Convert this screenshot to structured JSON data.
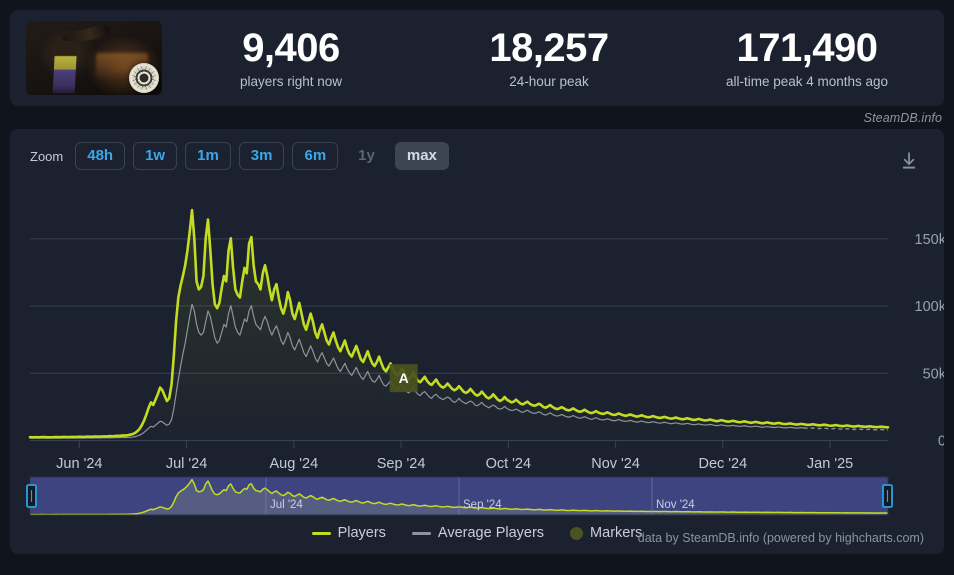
{
  "watermark": "SteamDB.info",
  "stats": {
    "capsule_alt": "game-capsule-artwork",
    "items": [
      {
        "value": "9,406",
        "label": "players right now"
      },
      {
        "value": "18,257",
        "label": "24-hour peak"
      },
      {
        "value": "171,490",
        "label": "all-time peak 4 months ago"
      }
    ]
  },
  "toolbar": {
    "zoom_label": "Zoom",
    "buttons": [
      {
        "label": "48h",
        "state": "enabled"
      },
      {
        "label": "1w",
        "state": "enabled"
      },
      {
        "label": "1m",
        "state": "enabled"
      },
      {
        "label": "3m",
        "state": "enabled"
      },
      {
        "label": "6m",
        "state": "enabled"
      },
      {
        "label": "1y",
        "state": "disabled"
      },
      {
        "label": "max",
        "state": "active"
      }
    ],
    "download_icon": "download-icon"
  },
  "legend": {
    "items": [
      {
        "label": "Players",
        "color": "#c3dc22",
        "marker": "line"
      },
      {
        "label": "Average Players",
        "color": "#8e949e",
        "marker": "line"
      },
      {
        "label": "Markers",
        "color": "#4b5320",
        "marker": "dot"
      }
    ]
  },
  "credit": "data by SteamDB.info (powered by highcharts.com)",
  "colors": {
    "page_bg": "#10141c",
    "card_bg": "#1b212e",
    "players": "#c3dc22",
    "average": "#8e949e",
    "markers": "#4b5320",
    "accent_blue": "#3aa8e8",
    "gridline": "#3a414f",
    "navigator_mask": "#3d4480",
    "handle": "#29a3e0"
  },
  "chart_data": {
    "type": "line",
    "title": "",
    "xlabel": "",
    "ylabel": "",
    "ylim": [
      0,
      180000
    ],
    "ytick_labels": [
      "0",
      "50k",
      "100k",
      "150k"
    ],
    "ytick_values": [
      0,
      50000,
      100000,
      150000
    ],
    "xtick_labels": [
      "Jun '24",
      "Jul '24",
      "Aug '24",
      "Sep '24",
      "Oct '24",
      "Nov '24",
      "Dec '24",
      "Jan '25"
    ],
    "grid": true,
    "legend_position": "bottom",
    "annotations": [
      {
        "label": "A",
        "type": "flag-marker",
        "x_frac": 0.432,
        "y_value": 46000
      }
    ],
    "navigator": {
      "xtick_labels": [
        "Jul '24",
        "Sep '24",
        "Nov '24"
      ],
      "selection": "full-range",
      "left_handle": true,
      "right_handle": true
    },
    "series": [
      {
        "name": "Players",
        "color": "#c3dc22",
        "values": [
          2100,
          2000,
          2050,
          2100,
          2000,
          2150,
          2200,
          2100,
          2000,
          2050,
          2100,
          2200,
          2150,
          2100,
          2200,
          2250,
          2200,
          2150,
          2300,
          2250,
          2200,
          2350,
          2400,
          2300,
          2350,
          2500,
          2450,
          2400,
          2550,
          2600,
          2500,
          2600,
          2700,
          2650,
          2700,
          2900,
          2800,
          2900,
          3100,
          3000,
          3200,
          3400,
          3300,
          3600,
          4000,
          4400,
          5200,
          6500,
          8200,
          11000,
          14500,
          19000,
          24000,
          28000,
          26000,
          30000,
          34000,
          39000,
          37000,
          33000,
          29000,
          31000,
          41000,
          62000,
          88000,
          106000,
          115000,
          122000,
          130000,
          141000,
          155000,
          171000,
          150000,
          118000,
          112000,
          114000,
          122000,
          150000,
          164000,
          142000,
          116000,
          101000,
          98000,
          102000,
          113000,
          122000,
          118000,
          141000,
          150000,
          128000,
          112000,
          108000,
          106000,
          118000,
          128000,
          124000,
          146000,
          151000,
          130000,
          118000,
          116000,
          112000,
          124000,
          130000,
          122000,
          112000,
          104000,
          112000,
          116000,
          106000,
          98000,
          94000,
          100000,
          110000,
          104000,
          94000,
          90000,
          96000,
          102000,
          94000,
          86000,
          82000,
          88000,
          94000,
          88000,
          80000,
          76000,
          82000,
          86000,
          80000,
          74000,
          71000,
          76000,
          80000,
          74000,
          69000,
          66000,
          70000,
          74000,
          68000,
          64000,
          62000,
          66000,
          70000,
          65000,
          60000,
          58000,
          62000,
          66000,
          61000,
          57000,
          55000,
          58000,
          62000,
          57000,
          53000,
          51000,
          54000,
          57000,
          53000,
          50000,
          48000,
          50000,
          53000,
          50000,
          47000,
          45000,
          47000,
          50000,
          47000,
          44000,
          43000,
          45000,
          47000,
          44000,
          42000,
          41000,
          43000,
          45000,
          42000,
          40000,
          39000,
          40000,
          42000,
          40000,
          38000,
          37000,
          38000,
          40000,
          38000,
          36000,
          35000,
          36000,
          38000,
          36000,
          34000,
          33000,
          34000,
          36000,
          34000,
          32000,
          31000,
          32000,
          34000,
          32000,
          30000,
          29000,
          30000,
          32000,
          30000,
          29000,
          28000,
          28500,
          30000,
          28500,
          27000,
          26500,
          27500,
          28500,
          27000,
          26000,
          25500,
          26000,
          27000,
          26000,
          24500,
          24000,
          25000,
          26000,
          24500,
          23500,
          23000,
          23500,
          24500,
          23500,
          22500,
          22000,
          22500,
          23500,
          22500,
          21500,
          21000,
          21500,
          22500,
          21500,
          20500,
          20000,
          20500,
          21500,
          20500,
          19800,
          19400,
          19800,
          20600,
          19800,
          19000,
          18600,
          19000,
          19800,
          19000,
          18400,
          18000,
          18400,
          19000,
          18400,
          17800,
          17400,
          17800,
          18400,
          17800,
          17200,
          16900,
          17200,
          17800,
          17200,
          16700,
          16400,
          16700,
          17200,
          16700,
          16200,
          15900,
          16200,
          16700,
          16200,
          15700,
          15400,
          15700,
          16200,
          15700,
          15200,
          14900,
          15200,
          15700,
          15200,
          14800,
          14500,
          14800,
          15200,
          14800,
          14300,
          14000,
          14300,
          14800,
          14300,
          13900,
          13600,
          13900,
          14300,
          13900,
          13500,
          13200,
          13500,
          13900,
          13500,
          13100,
          12800,
          13100,
          13500,
          13100,
          12700,
          12400,
          12700,
          13100,
          12700,
          12400,
          12100,
          12400,
          12700,
          12400,
          12000,
          11800,
          12000,
          12400,
          12000,
          11700,
          11500,
          11700,
          12000,
          11700,
          11400,
          11200,
          11400,
          11700,
          11400,
          11100,
          10900,
          11100,
          11400,
          11100,
          10800,
          10600,
          10800,
          11100,
          10800,
          10500,
          10300,
          10500,
          10800,
          10500,
          10200,
          10000,
          10200,
          10500,
          10200,
          10000,
          9800,
          10000,
          10200,
          9900,
          9700,
          9600,
          9700,
          9900,
          9700,
          9500,
          9406
        ]
      },
      {
        "name": "Average Players",
        "color": "#8e949e",
        "dashed_tail": true,
        "values": [
          1400,
          1350,
          1380,
          1400,
          1360,
          1420,
          1440,
          1400,
          1360,
          1380,
          1400,
          1440,
          1420,
          1400,
          1440,
          1460,
          1440,
          1420,
          1480,
          1460,
          1440,
          1500,
          1520,
          1480,
          1500,
          1550,
          1530,
          1510,
          1580,
          1600,
          1560,
          1600,
          1640,
          1620,
          1640,
          1700,
          1680,
          1700,
          1760,
          1730,
          1800,
          1860,
          1830,
          1920,
          2050,
          2200,
          2500,
          3000,
          3600,
          4500,
          5700,
          7200,
          8800,
          10200,
          9600,
          11000,
          12400,
          14000,
          13400,
          12200,
          11000,
          11800,
          15000,
          23000,
          34000,
          45000,
          55000,
          64000,
          72000,
          82000,
          92000,
          101000,
          96000,
          86000,
          80000,
          78000,
          80000,
          88000,
          96000,
          92000,
          84000,
          76000,
          72000,
          74000,
          80000,
          86000,
          84000,
          94000,
          100000,
          92000,
          84000,
          80000,
          78000,
          84000,
          90000,
          88000,
          96000,
          100000,
          92000,
          86000,
          84000,
          82000,
          88000,
          92000,
          88000,
          82000,
          78000,
          82000,
          85000,
          80000,
          74000,
          71000,
          75000,
          80000,
          76000,
          70000,
          67000,
          71000,
          75000,
          70000,
          65000,
          62000,
          66000,
          70000,
          66000,
          61000,
          58000,
          62000,
          65000,
          61000,
          57000,
          55000,
          58000,
          61000,
          57000,
          53000,
          51000,
          54000,
          57000,
          53000,
          50000,
          48000,
          51000,
          54000,
          50000,
          47000,
          45000,
          48000,
          51000,
          47000,
          44000,
          43000,
          45000,
          48000,
          44000,
          41000,
          40000,
          42000,
          44000,
          41000,
          39000,
          37000,
          39000,
          41000,
          39000,
          36000,
          35000,
          37000,
          39000,
          36000,
          34000,
          33000,
          35000,
          36000,
          34000,
          32000,
          31000,
          33000,
          34000,
          32000,
          31000,
          30000,
          31000,
          32000,
          31000,
          29000,
          28000,
          29000,
          31000,
          29000,
          28000,
          27000,
          28000,
          29000,
          28000,
          26000,
          25500,
          26500,
          28000,
          26000,
          25000,
          24000,
          25000,
          26000,
          25000,
          23500,
          23000,
          23500,
          25000,
          23500,
          22500,
          22000,
          22200,
          23000,
          22200,
          21000,
          20600,
          21400,
          22200,
          21000,
          20200,
          19800,
          20200,
          21000,
          20200,
          19000,
          18600,
          19400,
          20200,
          19000,
          18200,
          17800,
          18200,
          19000,
          18200,
          17400,
          17000,
          17400,
          18200,
          17400,
          16600,
          16200,
          16600,
          17400,
          16600,
          15800,
          15400,
          15800,
          16600,
          15800,
          15200,
          14900,
          15200,
          15800,
          15200,
          14600,
          14300,
          14600,
          15200,
          14600,
          14100,
          13800,
          14100,
          14600,
          14100,
          13600,
          13300,
          13600,
          14100,
          13600,
          13200,
          12900,
          13200,
          13600,
          13200,
          12800,
          12500,
          12800,
          13200,
          12800,
          12400,
          12100,
          12400,
          12800,
          12400,
          12000,
          11800,
          12000,
          12400,
          12000,
          11600,
          11400,
          11600,
          12000,
          11600,
          11300,
          11100,
          11300,
          11600,
          11300,
          10900,
          10700,
          10900,
          11300,
          10900,
          10600,
          10400,
          10600,
          10900,
          10600,
          10300,
          10100,
          10300,
          10600,
          10300,
          10000,
          9800,
          10000,
          10300,
          10000,
          9700,
          9500,
          9700,
          10000,
          9700,
          9500,
          9300,
          9500,
          9700,
          9500,
          9200,
          9000,
          9200,
          9500,
          9200,
          9000,
          8800,
          9000,
          9200,
          9000,
          8800,
          8600,
          8800,
          9000,
          8800,
          8600,
          8500,
          8600,
          8800,
          8600,
          8400,
          8200,
          8400,
          8600,
          8400,
          8200,
          8100,
          8200,
          8400,
          8200,
          8000,
          7900,
          8000,
          8200,
          8000,
          7900,
          7800,
          7900,
          8000,
          7800,
          7700,
          7600,
          7700,
          7800,
          7700,
          7600,
          7550
        ]
      }
    ],
    "navigator_series": {
      "name": "Players",
      "color": "#c3dc22"
    }
  }
}
